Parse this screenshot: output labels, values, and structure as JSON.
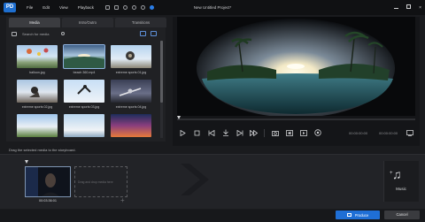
{
  "app": {
    "logo_text": "PD",
    "menu": [
      "File",
      "Edit",
      "View",
      "Playback"
    ],
    "project_title": "New Untitled Project*",
    "window_controls": {
      "minimize": "minimize-icon",
      "maximize": "maximize-icon",
      "close": "×"
    }
  },
  "media_panel": {
    "tabs": [
      {
        "label": "Media",
        "active": true
      },
      {
        "label": "Intro/Outro",
        "active": false
      },
      {
        "label": "Transitions",
        "active": false
      }
    ],
    "search_placeholder": "Search for media",
    "items": [
      {
        "caption": "balloon.jpg",
        "thumb": "balloon"
      },
      {
        "caption": "beach 360.mp4",
        "thumb": "beach",
        "selected": true
      },
      {
        "caption": "extreme sports 01.jpg",
        "thumb": "ext1"
      },
      {
        "caption": "extreme sports 02.jpg",
        "thumb": "ext2"
      },
      {
        "caption": "extreme sports 03.jpg",
        "thumb": "ext3"
      },
      {
        "caption": "extreme sports 04.jpg",
        "thumb": "ext4"
      },
      {
        "caption": "",
        "thumb": "r3a"
      },
      {
        "caption": "",
        "thumb": "r3b"
      },
      {
        "caption": "",
        "thumb": "r3c"
      }
    ]
  },
  "preview": {
    "timecode_current": "00:00:00:00",
    "timecode_total": "00:00:00:00",
    "controls": [
      "play-icon",
      "stop-icon",
      "previous-frame-icon",
      "split-icon",
      "next-frame-icon",
      "fast-forward-icon",
      "snapshot-icon",
      "volume-icon",
      "undock-icon",
      "settings-icon"
    ]
  },
  "storyboard": {
    "hint": "Drag the selected media to the storyboard.",
    "clip_time": "00:03:36:01",
    "drop_text": "Drag and drop media here",
    "music_label": "Music"
  },
  "bottom": {
    "produce_label": "Produce",
    "cancel_label": "Cancel"
  }
}
